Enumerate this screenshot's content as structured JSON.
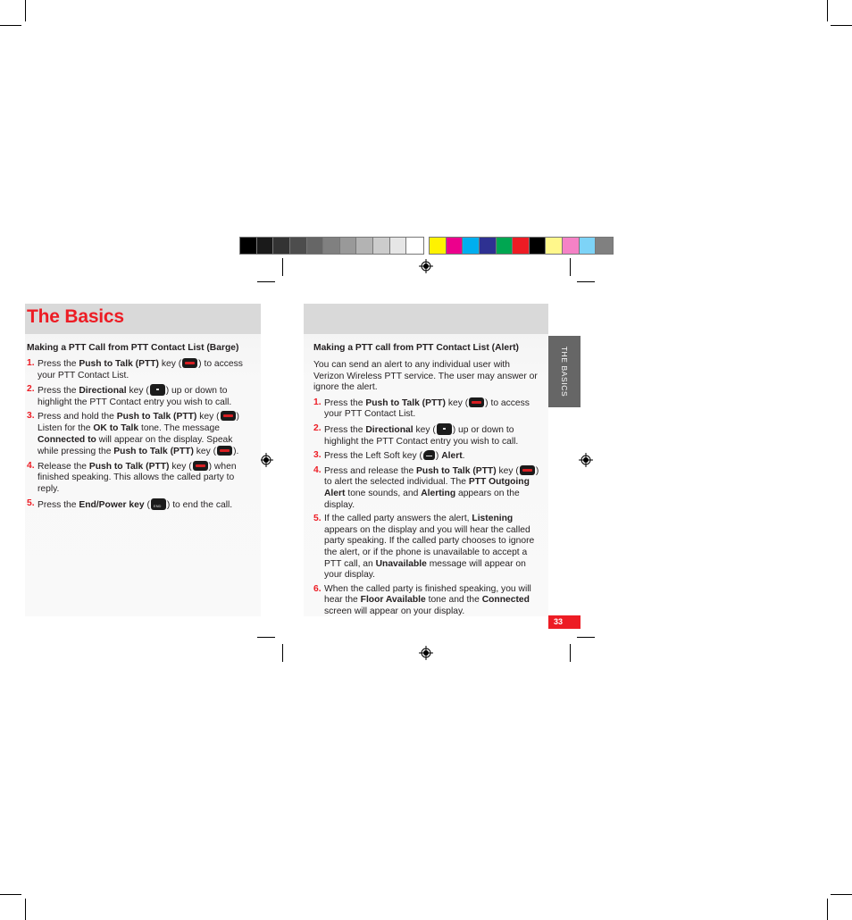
{
  "color_bar": {
    "grayscale": [
      "#000000",
      "#1a1a1a",
      "#333333",
      "#4d4d4d",
      "#666666",
      "#808080",
      "#999999",
      "#b3b3b3",
      "#cccccc",
      "#e6e6e6",
      "#ffffff"
    ],
    "process": [
      "#fff200",
      "#ec008c",
      "#00aeef",
      "#2e3192",
      "#00a651",
      "#ed1c24",
      "#000000",
      "#fff78b",
      "#f582c6",
      "#7dd3f7",
      "#808080"
    ]
  },
  "colors": {
    "accent": "#ed1c24",
    "header_band": "#d9d9d9",
    "tab_gray": "#666666"
  },
  "left": {
    "title": "The Basics",
    "section_title": "Making a PTT Call from PTT Contact List (Barge)",
    "steps": [
      {
        "num": "1.",
        "parts": [
          "Press the ",
          "Push to Talk (PTT)",
          " key (",
          "[ptt-key]",
          ") to access your PTT Contact List."
        ]
      },
      {
        "num": "2.",
        "parts": [
          "Press the ",
          "Directional",
          " key (",
          "[directional-key]",
          ") up or down to highlight the PTT Contact entry you wish to call."
        ]
      },
      {
        "num": "3.",
        "parts": [
          "Press and hold the ",
          "Push to Talk (PTT)",
          " key (",
          "[ptt-key]",
          ") Listen for the ",
          "OK to Talk",
          " tone. The message ",
          "Connected to",
          " will appear on the display. Speak while pressing the  ",
          "Push to Talk (PTT)",
          " key (",
          "[ptt-key]",
          ")."
        ]
      },
      {
        "num": "4.",
        "parts": [
          "Release the ",
          "Push to Talk (PTT)",
          " key (",
          "[ptt-key]",
          ") when finished speaking. This allows the called party to reply."
        ]
      },
      {
        "num": "5.",
        "parts": [
          "Press the ",
          "End/Power key",
          " (",
          "[end-key]",
          ") to end the call."
        ]
      }
    ]
  },
  "right": {
    "section_title": "Making a PTT call from PTT Contact List (Alert)",
    "intro": "You can send an alert to any individual user with Verizon Wireless PTT service. The user may answer or ignore the alert.",
    "steps": [
      {
        "num": "1.",
        "parts": [
          "Press the ",
          "Push to Talk (PTT)",
          " key (",
          "[ptt-key]",
          ") to access your PTT Contact List."
        ]
      },
      {
        "num": "2.",
        "parts": [
          "Press the ",
          "Directional",
          " key (",
          "[directional-key]",
          ") up or down to highlight the PTT Contact entry you wish to call."
        ]
      },
      {
        "num": "3.",
        "parts": [
          "Press the Left Soft key (",
          "[soft-key]",
          ") ",
          "Alert",
          "."
        ]
      },
      {
        "num": "4.",
        "parts": [
          "Press and release the ",
          "Push to Talk (PTT)",
          " key (",
          "[ptt-key]",
          ") to alert the selected individual. The ",
          "PTT Outgoing Alert",
          " tone sounds, and ",
          "Alerting",
          " appears on the display."
        ]
      },
      {
        "num": "5.",
        "parts": [
          "If the called party answers the alert, ",
          "Listening",
          " appears on the display and you will hear the called party speaking. If the called party chooses to ignore the alert, or if the phone is unavailable to accept a PTT call, an ",
          "Unavailable",
          " message will appear on your display."
        ]
      },
      {
        "num": "6.",
        "parts": [
          "When the called party is finished speaking, you will hear the ",
          "Floor Available",
          " tone and the ",
          "Connected",
          " screen will appear on your display."
        ]
      }
    ]
  },
  "side_tab": {
    "label": "THE BASICS"
  },
  "page_number": "33"
}
